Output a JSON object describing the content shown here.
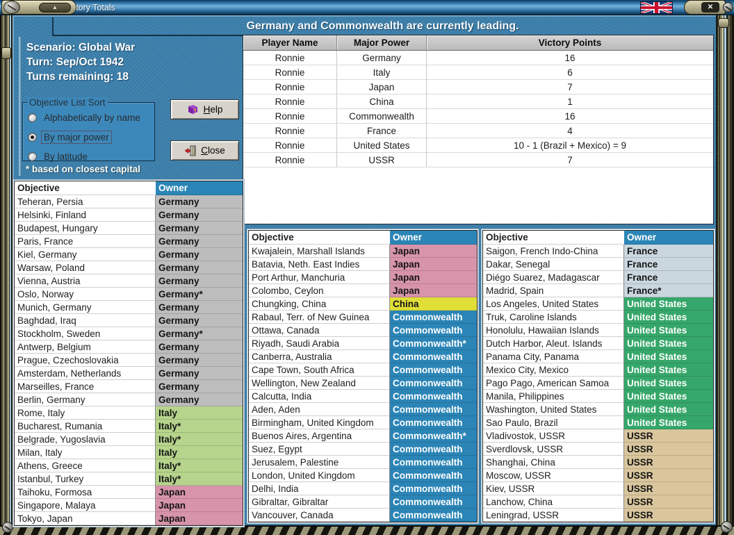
{
  "window": {
    "title": "Victory Totals"
  },
  "icons": {
    "up_arrow": "▲",
    "close": "✕"
  },
  "colors": {
    "background_blue": "#3C80AC",
    "titlebar_blue": "#2E72A4",
    "list_header_teal": "#2B85B6",
    "frame_tan": "#A8A488"
  },
  "header": {
    "message": "Germany and Commonwealth are currently leading."
  },
  "scenario": {
    "line1": "Scenario: Global War",
    "line2": "Turn: Sep/Oct 1942",
    "line3": "Turns remaining: 18"
  },
  "sort_box": {
    "label": "Objective List Sort",
    "options": [
      {
        "label": "Alphabetically by name",
        "selected": false
      },
      {
        "label": "By major power",
        "selected": true
      },
      {
        "label": "By latitude",
        "selected": false
      }
    ],
    "footnote": "* based on closest capital"
  },
  "buttons": {
    "help": "Help",
    "close": "Close"
  },
  "victory_table": {
    "headers": [
      "Player Name",
      "Major Power",
      "Victory Points"
    ],
    "rows": [
      [
        "Ronnie",
        "Germany",
        "16"
      ],
      [
        "Ronnie",
        "Italy",
        "6"
      ],
      [
        "Ronnie",
        "Japan",
        "7"
      ],
      [
        "Ronnie",
        "China",
        "1"
      ],
      [
        "Ronnie",
        "Commonwealth",
        "16"
      ],
      [
        "Ronnie",
        "France",
        "4"
      ],
      [
        "Ronnie",
        "United States",
        "10 - 1 (Brazil + Mexico) = 9"
      ],
      [
        "Ronnie",
        "USSR",
        "7"
      ]
    ]
  },
  "owner_colors": {
    "Germany": {
      "bg": "#BDBDBD",
      "fg": "#141414"
    },
    "Italy": {
      "bg": "#B7D48C",
      "fg": "#141414"
    },
    "Japan": {
      "bg": "#D794AA",
      "fg": "#141414"
    },
    "China": {
      "bg": "#DFDF38",
      "fg": "#141414"
    },
    "Commonwealth": {
      "bg": "#2B85B6",
      "fg": "#FFFFFF"
    },
    "France": {
      "bg": "#CAD7DF",
      "fg": "#141414"
    },
    "United States": {
      "bg": "#36A76A",
      "fg": "#FFFFFF"
    },
    "USSR": {
      "bg": "#D9C69D",
      "fg": "#141414"
    }
  },
  "objective_lists": [
    {
      "headers": [
        "Objective",
        "Owner"
      ],
      "rows": [
        {
          "objective": "Teheran, Persia",
          "owner": "Germany"
        },
        {
          "objective": "Helsinki, Finland",
          "owner": "Germany"
        },
        {
          "objective": "Budapest, Hungary",
          "owner": "Germany"
        },
        {
          "objective": "Paris, France",
          "owner": "Germany"
        },
        {
          "objective": "Kiel, Germany",
          "owner": "Germany"
        },
        {
          "objective": "Warsaw, Poland",
          "owner": "Germany"
        },
        {
          "objective": "Vienna, Austria",
          "owner": "Germany"
        },
        {
          "objective": "Oslo, Norway",
          "owner": "Germany*"
        },
        {
          "objective": "Munich, Germany",
          "owner": "Germany"
        },
        {
          "objective": "Baghdad, Iraq",
          "owner": "Germany"
        },
        {
          "objective": "Stockholm, Sweden",
          "owner": "Germany*"
        },
        {
          "objective": "Antwerp, Belgium",
          "owner": "Germany"
        },
        {
          "objective": "Prague, Czechoslovakia",
          "owner": "Germany"
        },
        {
          "objective": "Amsterdam, Netherlands",
          "owner": "Germany"
        },
        {
          "objective": "Marseilles, France",
          "owner": "Germany"
        },
        {
          "objective": "Berlin, Germany",
          "owner": "Germany"
        },
        {
          "objective": "Rome, Italy",
          "owner": "Italy"
        },
        {
          "objective": "Bucharest, Rumania",
          "owner": "Italy*"
        },
        {
          "objective": "Belgrade, Yugoslavia",
          "owner": "Italy*"
        },
        {
          "objective": "Milan, Italy",
          "owner": "Italy"
        },
        {
          "objective": "Athens, Greece",
          "owner": "Italy*"
        },
        {
          "objective": "Istanbul, Turkey",
          "owner": "Italy*"
        },
        {
          "objective": "Taihoku, Formosa",
          "owner": "Japan"
        },
        {
          "objective": "Singapore, Malaya",
          "owner": "Japan"
        },
        {
          "objective": "Tokyo, Japan",
          "owner": "Japan"
        }
      ]
    },
    {
      "headers": [
        "Objective",
        "Owner"
      ],
      "rows": [
        {
          "objective": "Kwajalein, Marshall Islands",
          "owner": "Japan"
        },
        {
          "objective": "Batavia, Neth. East Indies",
          "owner": "Japan"
        },
        {
          "objective": "Port Arthur, Manchuria",
          "owner": "Japan"
        },
        {
          "objective": "Colombo, Ceylon",
          "owner": "Japan"
        },
        {
          "objective": "Chungking, China",
          "owner": "China"
        },
        {
          "objective": "Rabaul, Terr. of New Guinea",
          "owner": "Commonwealth"
        },
        {
          "objective": "Ottawa, Canada",
          "owner": "Commonwealth"
        },
        {
          "objective": "Riyadh, Saudi Arabia",
          "owner": "Commonwealth*"
        },
        {
          "objective": "Canberra, Australia",
          "owner": "Commonwealth"
        },
        {
          "objective": "Cape Town, South Africa",
          "owner": "Commonwealth"
        },
        {
          "objective": "Wellington, New Zealand",
          "owner": "Commonwealth"
        },
        {
          "objective": "Calcutta, India",
          "owner": "Commonwealth"
        },
        {
          "objective": "Aden, Aden",
          "owner": "Commonwealth"
        },
        {
          "objective": "Birmingham, United Kingdom",
          "owner": "Commonwealth"
        },
        {
          "objective": "Buenos Aires, Argentina",
          "owner": "Commonwealth*"
        },
        {
          "objective": "Suez, Egypt",
          "owner": "Commonwealth"
        },
        {
          "objective": "Jerusalem, Palestine",
          "owner": "Commonwealth"
        },
        {
          "objective": "London, United Kingdom",
          "owner": "Commonwealth"
        },
        {
          "objective": "Delhi, India",
          "owner": "Commonwealth"
        },
        {
          "objective": "Gibraltar, Gibraltar",
          "owner": "Commonwealth"
        },
        {
          "objective": "Vancouver, Canada",
          "owner": "Commonwealth"
        }
      ]
    },
    {
      "headers": [
        "Objective",
        "Owner"
      ],
      "rows": [
        {
          "objective": "Saigon, French Indo-China",
          "owner": "France"
        },
        {
          "objective": "Dakar, Senegal",
          "owner": "France"
        },
        {
          "objective": "Diégo Suarez, Madagascar",
          "owner": "France"
        },
        {
          "objective": "Madrid, Spain",
          "owner": "France*"
        },
        {
          "objective": "Los Angeles, United States",
          "owner": "United States"
        },
        {
          "objective": "Truk, Caroline Islands",
          "owner": "United States"
        },
        {
          "objective": "Honolulu, Hawaiian Islands",
          "owner": "United States"
        },
        {
          "objective": "Dutch Harbor, Aleut. Islands",
          "owner": "United States"
        },
        {
          "objective": "Panama City, Panama",
          "owner": "United States"
        },
        {
          "objective": "Mexico City, Mexico",
          "owner": "United States"
        },
        {
          "objective": "Pago Pago, American Samoa",
          "owner": "United States"
        },
        {
          "objective": "Manila, Philippines",
          "owner": "United States"
        },
        {
          "objective": "Washington, United States",
          "owner": "United States"
        },
        {
          "objective": "Sao Paulo, Brazil",
          "owner": "United States"
        },
        {
          "objective": "Vladivostok, USSR",
          "owner": "USSR"
        },
        {
          "objective": "Sverdlovsk, USSR",
          "owner": "USSR"
        },
        {
          "objective": "Shanghai, China",
          "owner": "USSR"
        },
        {
          "objective": "Moscow, USSR",
          "owner": "USSR"
        },
        {
          "objective": "Kiev, USSR",
          "owner": "USSR"
        },
        {
          "objective": "Lanchow, China",
          "owner": "USSR"
        },
        {
          "objective": "Leningrad, USSR",
          "owner": "USSR"
        }
      ]
    }
  ]
}
